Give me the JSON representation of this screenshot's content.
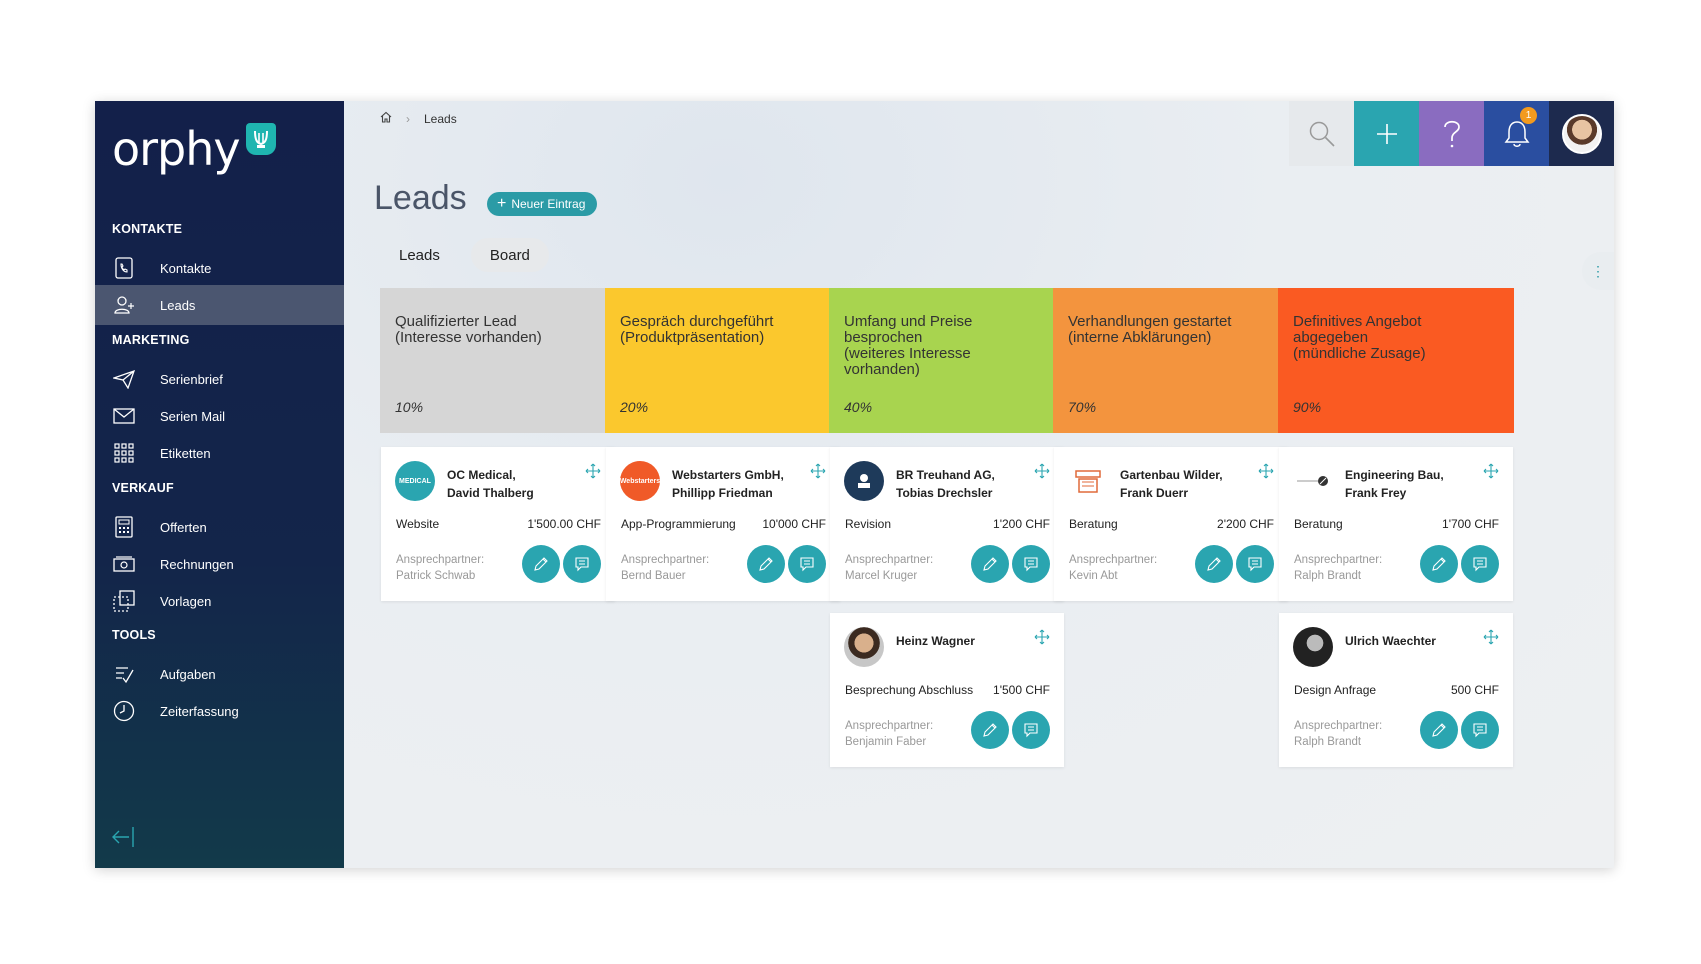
{
  "app": {
    "logo_text": "orphy"
  },
  "sidebar": {
    "sections": {
      "kontakte": "KONTAKTE",
      "marketing": "MARKETING",
      "verkauf": "VERKAUF",
      "tools": "TOOLS"
    },
    "items": [
      {
        "label": "Kontakte",
        "icon": "phone-book-icon"
      },
      {
        "label": "Leads",
        "icon": "user-lead-icon"
      },
      {
        "label": "Serienbrief",
        "icon": "paper-plane-icon"
      },
      {
        "label": "Serien Mail",
        "icon": "envelope-icon"
      },
      {
        "label": "Etiketten",
        "icon": "grid-labels-icon"
      },
      {
        "label": "Offerten",
        "icon": "calculator-icon"
      },
      {
        "label": "Rechnungen",
        "icon": "money-bill-icon"
      },
      {
        "label": "Vorlagen",
        "icon": "template-icon"
      },
      {
        "label": "Aufgaben",
        "icon": "task-check-icon"
      },
      {
        "label": "Zeiterfassung",
        "icon": "clock-icon"
      }
    ],
    "active_item": "Leads"
  },
  "breadcrumb": {
    "current": "Leads"
  },
  "topbar": {
    "notification_count": "1"
  },
  "page": {
    "title": "Leads",
    "new_button": "Neuer Eintrag",
    "tabs": [
      "Leads",
      "Board"
    ],
    "active_tab": "Board"
  },
  "columns": [
    {
      "title": "Qualifizierter Lead\n(Interesse vorhanden)",
      "percent": "10%",
      "color": "#d6d6d6"
    },
    {
      "title": "Gespräch durchgeführt\n(Produktpräsentation)",
      "percent": "20%",
      "color": "#fbc82d"
    },
    {
      "title": "Umfang und Preise\nbesprochen\n(weiteres Interesse\nvorhanden)",
      "percent": "40%",
      "color": "#a8d44f"
    },
    {
      "title": "Verhandlungen gestartet\n(interne Abklärungen)",
      "percent": "70%",
      "color": "#f3943e"
    },
    {
      "title": "Definitives Angebot\nabgegeben\n(mündliche Zusage)",
      "percent": "90%",
      "color": "#fa5a22"
    }
  ],
  "cards": [
    {
      "company": "OC Medical,",
      "person": "David Thalberg",
      "service": "Website",
      "amount": "1'500.00 CHF",
      "contact_label": "Ansprechpartner:",
      "contact": "Patrick Schwab",
      "logo_text": "MEDICAL"
    },
    {
      "company": "Webstarters GmbH,",
      "person": "Phillipp Friedman",
      "service": "App-Programmierung",
      "amount": "10'000 CHF",
      "contact_label": "Ansprechpartner:",
      "contact": "Bernd Bauer",
      "logo_text": "Webstarters"
    },
    {
      "company": "BR Treuhand AG,",
      "person": "Tobias Drechsler",
      "service": "Revision",
      "amount": "1'200 CHF",
      "contact_label": "Ansprechpartner:",
      "contact": "Marcel Kruger",
      "logo_text": ""
    },
    {
      "company": "Heinz Wagner",
      "person": "",
      "service": "Besprechung Abschluss",
      "amount": "1'500 CHF",
      "contact_label": "Ansprechpartner:",
      "contact": "Benjamin Faber",
      "logo_text": ""
    },
    {
      "company": "Gartenbau Wilder,",
      "person": "Frank Duerr",
      "service": "Beratung",
      "amount": "2'200 CHF",
      "contact_label": "Ansprechpartner:",
      "contact": "Kevin Abt",
      "logo_text": ""
    },
    {
      "company": "Engineering Bau,",
      "person": "Frank Frey",
      "service": "Beratung",
      "amount": "1'700 CHF",
      "contact_label": "Ansprechpartner:",
      "contact": "Ralph Brandt",
      "logo_text": ""
    },
    {
      "company": "Ulrich Waechter",
      "person": "",
      "service": "Design Anfrage",
      "amount": "500 CHF",
      "contact_label": "Ansprechpartner:",
      "contact": "Ralph Brandt",
      "logo_text": ""
    }
  ],
  "colors": {
    "sidebar": "#13204a",
    "accent": "#2aa5b0",
    "help": "#8a6cc0",
    "bell": "#2a4ea0",
    "badge": "#f39a1e"
  }
}
